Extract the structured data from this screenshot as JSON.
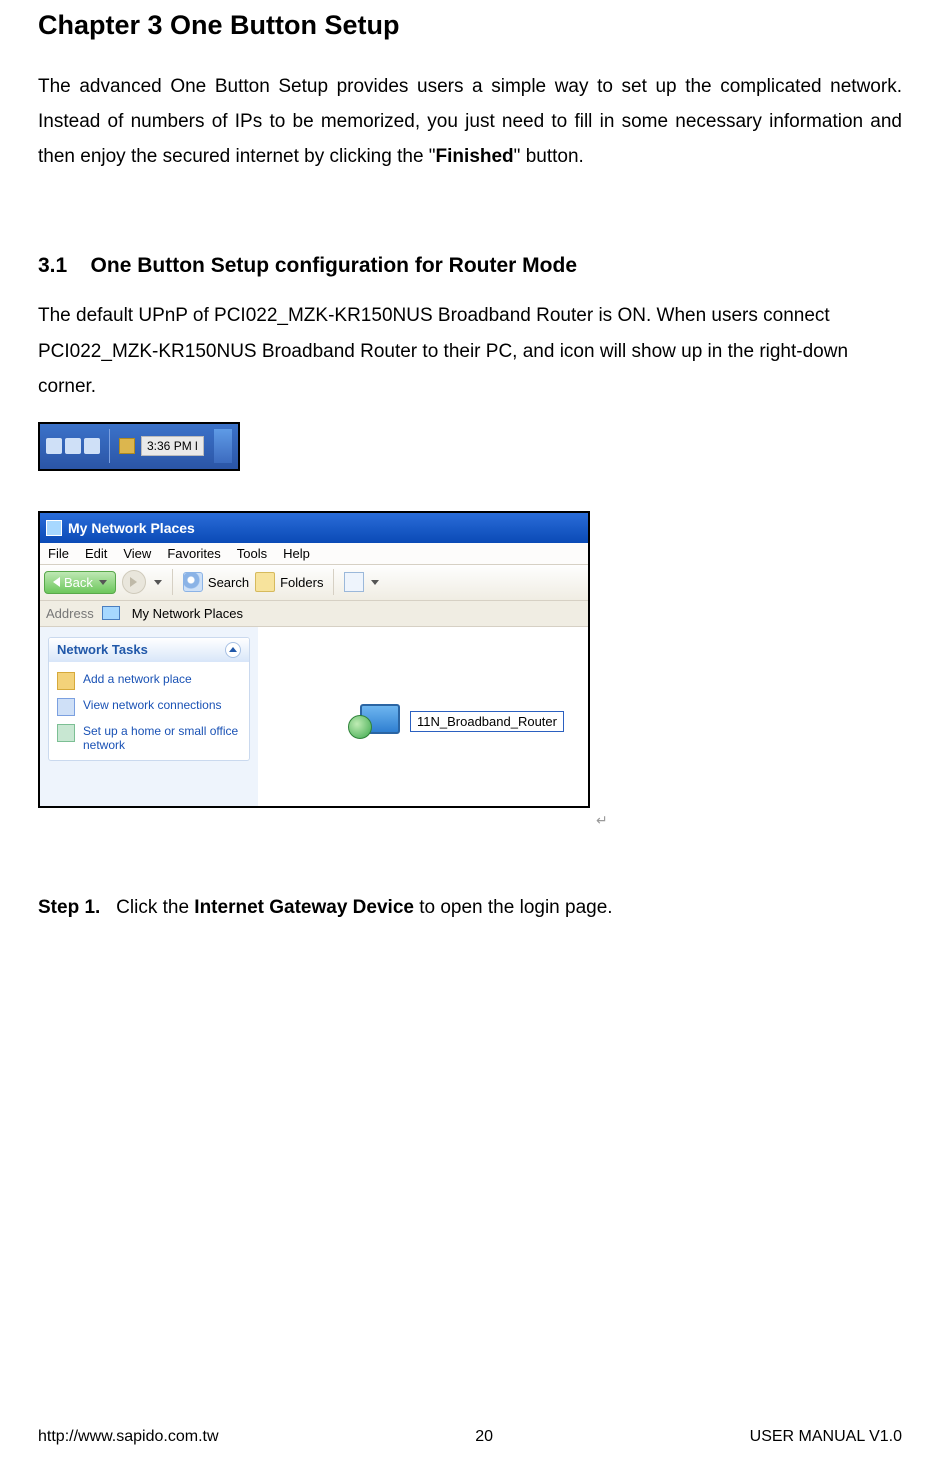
{
  "chapter": {
    "title": "Chapter 3    One Button Setup"
  },
  "intro": {
    "part1": "The advanced One Button Setup provides users a simple way to set up the complicated network.   Instead of numbers of IPs to be memorized, you just need to fill in some necessary information and then enjoy the secured internet by clicking the \"",
    "bold": "Finished",
    "part2": "\" button."
  },
  "section": {
    "num": "3.1",
    "title": "One Button Setup configuration for Router Mode",
    "para": "The default UPnP of PCI022_MZK-KR150NUS Broadband Router is ON. When users connect PCI022_MZK-KR150NUS Broadband Router to their PC, and icon will show up in the right-down corner."
  },
  "taskbar": {
    "time": "3:36 PM l"
  },
  "window": {
    "title": "My Network Places",
    "menu": {
      "file": "File",
      "edit": "Edit",
      "view": "View",
      "favorites": "Favorites",
      "tools": "Tools",
      "help": "Help"
    },
    "toolbar": {
      "back": "Back",
      "search": "Search",
      "folders": "Folders"
    },
    "address": {
      "label": "Address",
      "value": "My Network Places"
    },
    "panel": {
      "header": "Network Tasks",
      "tasks": {
        "add": "Add a network place",
        "view": "View network connections",
        "home": "Set up a home or small office network"
      }
    },
    "device_label": "11N_Broadband_Router"
  },
  "step": {
    "prefix": "Step 1.",
    "text1": "Click the ",
    "bold": "Internet Gateway Device",
    "text2": " to open the login page."
  },
  "footer": {
    "url": "http://www.sapido.com.tw",
    "page": "20",
    "version": "USER MANUAL V1.0"
  }
}
